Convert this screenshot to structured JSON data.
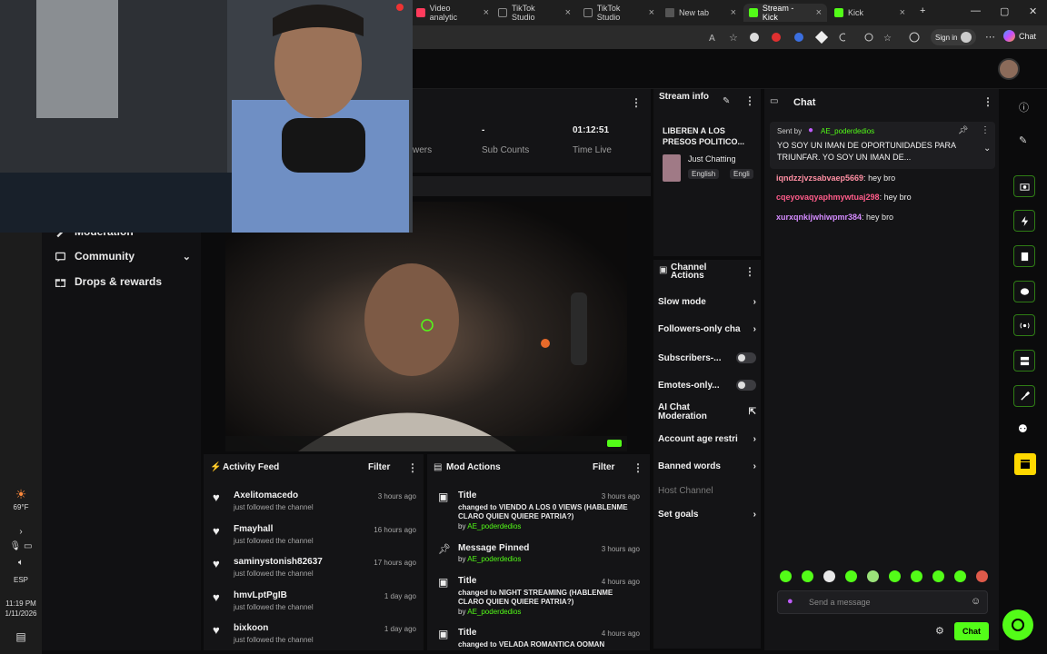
{
  "browser": {
    "tabs": [
      {
        "label": "Video analytic",
        "active": false
      },
      {
        "label": "TikTok Studio",
        "active": false
      },
      {
        "label": "TikTok Studio",
        "active": false
      },
      {
        "label": "New tab",
        "active": false
      },
      {
        "label": "Stream - Kick",
        "active": true
      },
      {
        "label": "Kick",
        "active": false
      }
    ],
    "signin_label": "Sign in",
    "chat_label": "Chat"
  },
  "sidebar": {
    "items": [
      {
        "label": "Moderation"
      },
      {
        "label": "Community"
      },
      {
        "label": "Drops & rewards"
      }
    ]
  },
  "stats": {
    "viewers_label": "wers",
    "sub_counts_value": "-",
    "sub_counts_label": "Sub Counts",
    "time_live_value": "01:12:51",
    "time_live_label": "Time Live"
  },
  "stream_info": {
    "title": "Stream info",
    "stream_title": "LIBEREN A LOS PRESOS POLITICO...",
    "category": "Just Chatting",
    "tags": [
      "English",
      "Engli"
    ]
  },
  "channel_actions": {
    "title": "Channel Actions",
    "items": [
      {
        "label": "Slow mode",
        "kind": "arrow"
      },
      {
        "label": "Followers-only cha",
        "kind": "arrow"
      },
      {
        "label": "Subscribers-...",
        "kind": "toggle"
      },
      {
        "label": "Emotes-only...",
        "kind": "toggle"
      },
      {
        "label": "AI Chat Moderation",
        "kind": "external"
      },
      {
        "label": "Account age restri",
        "kind": "arrow"
      },
      {
        "label": "Banned words",
        "kind": "arrow"
      },
      {
        "label": "Host Channel",
        "kind": "disabled"
      },
      {
        "label": "Set goals",
        "kind": "arrow"
      }
    ]
  },
  "chat": {
    "title": "Chat",
    "pinned": {
      "sent_by_label": "Sent by",
      "author": "AE_poderdedios",
      "text": "YO SOY UN IMAN DE OPORTUNIDADES PARA TRIUNFAR. YO SOY UN IMAN DE..."
    },
    "messages": [
      {
        "user": "iqndzzjvzsabvaep5669",
        "text": "hey bro",
        "color": "#ff8fa3"
      },
      {
        "user": "cqeyovaqyaphmywtuaj298",
        "text": "hey bro",
        "color": "#ff5c8a"
      },
      {
        "user": "xurxqnkijwhiwpmr384",
        "text": "hey bro",
        "color": "#d58cff"
      }
    ],
    "input_placeholder": "Send a message",
    "send_label": "Chat"
  },
  "activity_feed": {
    "title": "Activity Feed",
    "filter_label": "Filter",
    "items": [
      {
        "name": "Axelitomacedo",
        "sub": "just followed the channel",
        "time": "3 hours ago"
      },
      {
        "name": "Fmayhall",
        "sub": "just followed the channel",
        "time": "16 hours ago"
      },
      {
        "name": "saminystonish82637",
        "sub": "just followed the channel",
        "time": "17 hours ago"
      },
      {
        "name": "hmvLptPgIB",
        "sub": "just followed the channel",
        "time": "1 day ago"
      },
      {
        "name": "bixkoon",
        "sub": "just followed the channel",
        "time": "1 day ago"
      }
    ]
  },
  "mod_actions": {
    "title": "Mod Actions",
    "filter_label": "Filter",
    "items": [
      {
        "title": "Title",
        "desc": "changed to VIENDO A LOS 0 VIEWS (HABLENME CLARO QUIEN QUIERE PATRIA?)",
        "by_prefix": "by",
        "by": "AE_poderdedios",
        "time": "3 hours ago"
      },
      {
        "title": "Message Pinned",
        "desc": "",
        "by_prefix": "by",
        "by": "AE_poderdedios",
        "time": "3 hours ago"
      },
      {
        "title": "Title",
        "desc": "changed to NIGHT STREAMING (HABLENME CLARO QUIEN QUIERE PATRIA?)",
        "by_prefix": "by",
        "by": "AE_poderdedios",
        "time": "4 hours ago"
      },
      {
        "title": "Title",
        "desc": "changed to VELADA ROMANTICA OOMAN",
        "by_prefix": "",
        "by": "",
        "time": "4 hours ago"
      }
    ]
  },
  "taskbar": {
    "weather_temp": "69°F",
    "lang": "ESP",
    "time": "11:19 PM",
    "date": "1/11/2026"
  },
  "colors": {
    "accent": "#53fc18",
    "panel": "#141416",
    "background": "#0b0b0c"
  }
}
